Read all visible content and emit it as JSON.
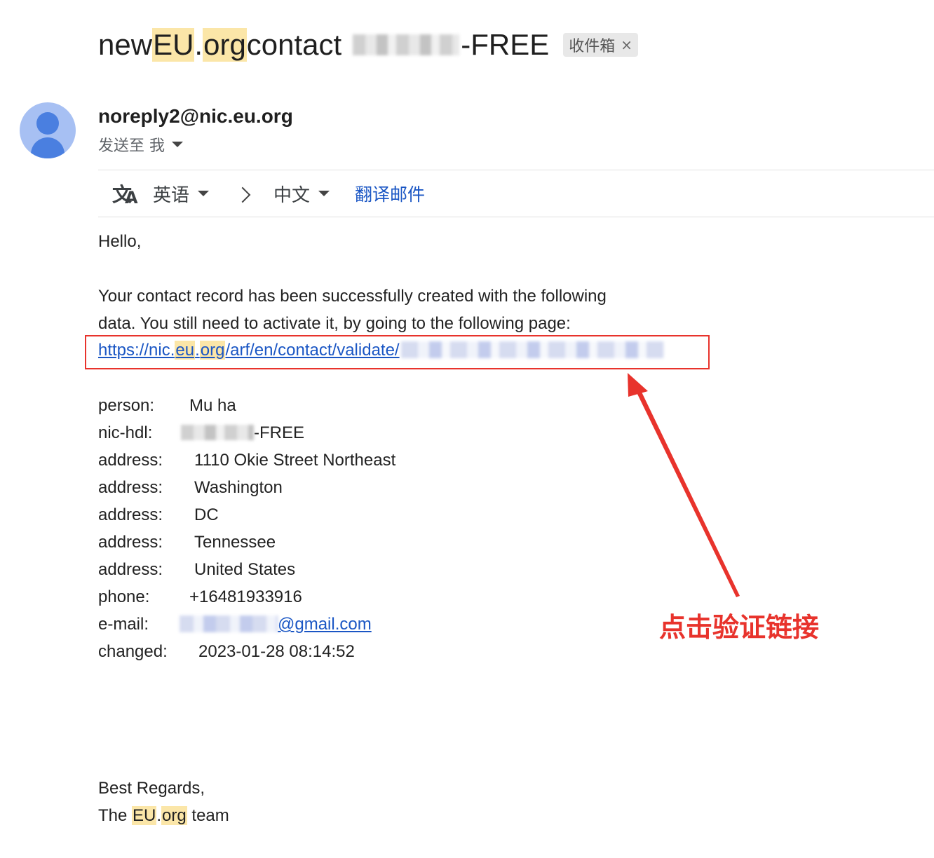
{
  "subject": {
    "part1": "new ",
    "hl1": "EU",
    "part2": ".",
    "hl2": "org",
    "part3": " contact ",
    "suffix": "-FREE",
    "chip_label": "收件箱",
    "chip_close": "×"
  },
  "sender": {
    "email": "noreply2@nic.eu.org",
    "to_label": "发送至 我"
  },
  "translate": {
    "source_lang": "英语",
    "target_lang": "中文",
    "action": "翻译邮件",
    "icon": "translate-icon"
  },
  "body": {
    "greeting": "Hello,",
    "para_line1": "Your contact record has been successfully created with the following",
    "para_line2": "data. You still need to activate it, by going to the following page:",
    "link_prefix": "https://nic.",
    "link_eu": "eu",
    "link_dot": ".",
    "link_org": "org",
    "link_rest": "/arf/en/contact/validate/"
  },
  "fields": [
    {
      "key": "person:",
      "value": "Mu ha"
    },
    {
      "key": "nic-hdl:",
      "value": "-FREE"
    },
    {
      "key": "address:",
      "value": "1110 Okie Street Northeast"
    },
    {
      "key": "address:",
      "value": "Washington"
    },
    {
      "key": "address:",
      "value": "DC"
    },
    {
      "key": "address:",
      "value": "Tennessee"
    },
    {
      "key": "address:",
      "value": "United States"
    },
    {
      "key": "phone:",
      "value": "+16481933916"
    },
    {
      "key": "e-mail:",
      "value": "@gmail.com"
    },
    {
      "key": "changed:",
      "value": "2023-01-28 08:14:52"
    }
  ],
  "closing": {
    "line1": "Best Regards,",
    "line2_prefix": "The ",
    "line2_eu": "EU",
    "line2_dot": ".",
    "line2_org": "org",
    "line2_suffix": " team"
  },
  "annotation": {
    "label": "点击验证链接",
    "color": "#e8332c"
  },
  "colors": {
    "highlight": "#fbe6a8",
    "link": "#1a56c4",
    "avatar_bg": "#a7c0f3",
    "avatar_fg": "#4a7fe0"
  }
}
